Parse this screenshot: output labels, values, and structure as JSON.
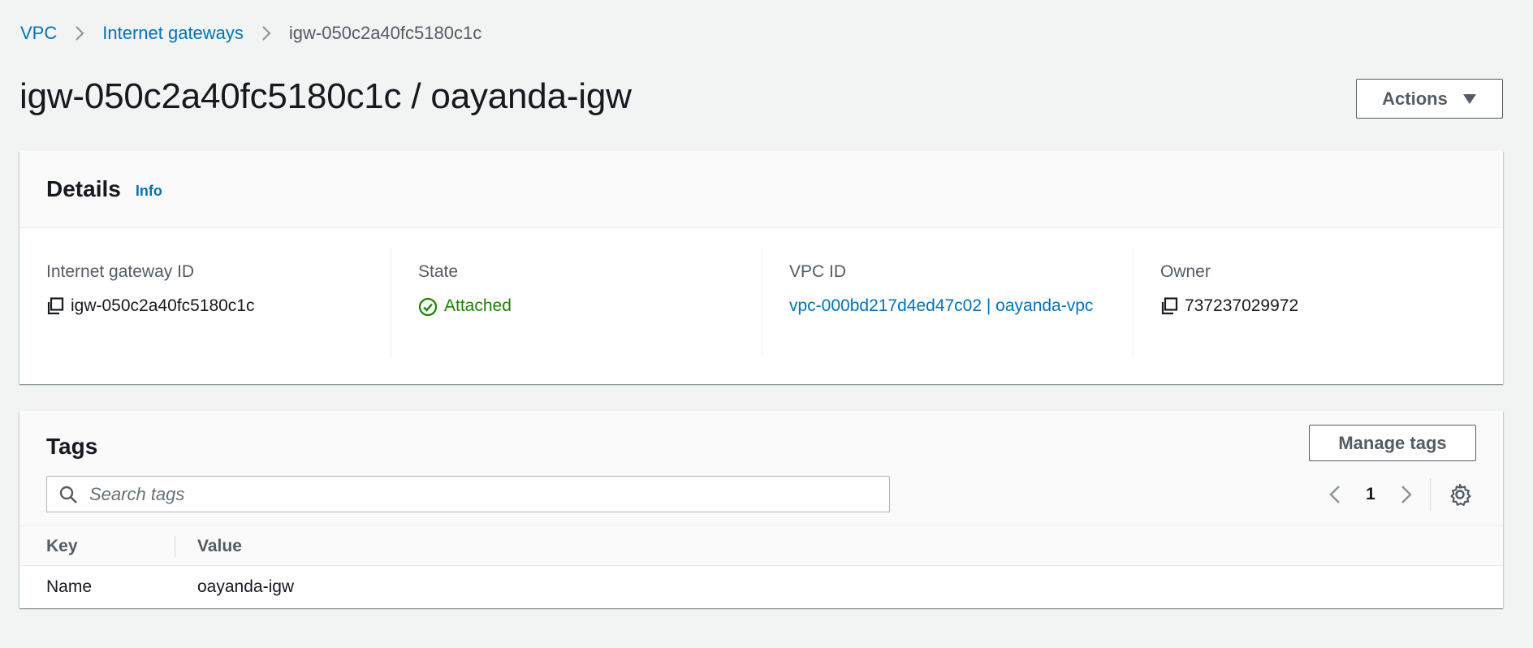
{
  "breadcrumb": {
    "items": [
      "VPC",
      "Internet gateways"
    ],
    "current": "igw-050c2a40fc5180c1c"
  },
  "header": {
    "title": "igw-050c2a40fc5180c1c / oayanda-igw",
    "actions_label": "Actions"
  },
  "details": {
    "title": "Details",
    "info_label": "Info",
    "fields": [
      {
        "label": "Internet gateway ID",
        "value": "igw-050c2a40fc5180c1c",
        "icon": "copy-icon"
      },
      {
        "label": "State",
        "value": "Attached",
        "icon": "check-circle-icon"
      },
      {
        "label": "VPC ID",
        "value": "vpc-000bd217d4ed47c02 | oayanda-vpc"
      },
      {
        "label": "Owner",
        "value": "737237029972",
        "icon": "copy-icon"
      }
    ]
  },
  "tags": {
    "title": "Tags",
    "manage_label": "Manage tags",
    "search_placeholder": "Search tags",
    "page": "1",
    "columns": [
      "Key",
      "Value"
    ],
    "rows": [
      {
        "key": "Name",
        "value": "oayanda-igw"
      }
    ]
  },
  "colors": {
    "link": "#0073bb",
    "success": "#1d8102",
    "background": "#f2f3f3",
    "text": "#16191f",
    "secondary_text": "#545b64"
  }
}
